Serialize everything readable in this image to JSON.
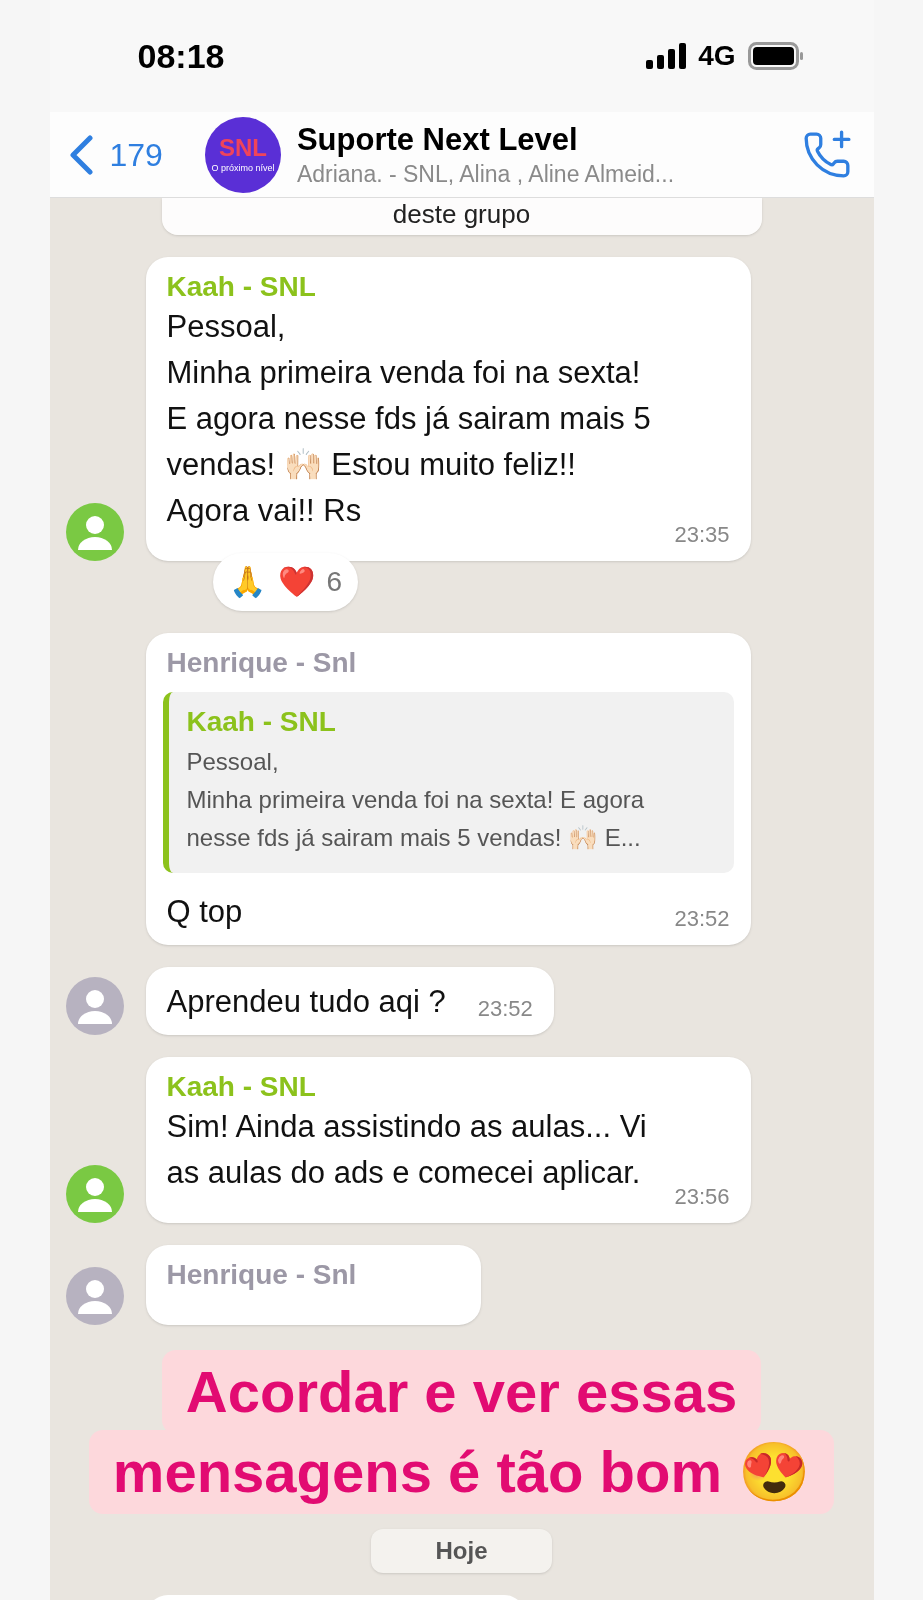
{
  "status_bar": {
    "time": "08:18",
    "network": "4G"
  },
  "header": {
    "back_count": "179",
    "logo": {
      "text": "SNL",
      "tagline": "O próximo nível"
    },
    "title": "Suporte Next Level",
    "subtitle": "Adriana. - SNL, Alina , Aline Almeid..."
  },
  "messages": [
    {
      "kind": "system",
      "lines": [
        "deste grupo"
      ]
    },
    {
      "kind": "incoming",
      "sender": "Kaah - SNL",
      "color": "#8cc21c",
      "avatar": {
        "color": "#7ac943"
      },
      "lines": [
        "Pessoal,",
        "Minha primeira venda foi na sexta!",
        "E agora nesse fds já sairam mais 5",
        "vendas! 🙌🏻 Estou muito feliz!!",
        "Agora vai!! Rs"
      ],
      "time": "23:35",
      "reactions": {
        "emojis": [
          "🙏",
          "❤️"
        ],
        "count": "6"
      }
    },
    {
      "kind": "incoming",
      "sender": "Henrique - Snl",
      "color": "#9c98a6",
      "quote": {
        "sender": "Kaah - SNL",
        "color": "#8cc21c",
        "lines": [
          "Pessoal,",
          "Minha primeira venda foi na sexta! E agora",
          "nesse fds já sairam mais 5 vendas! 🙌🏻 E..."
        ]
      },
      "lines": [
        "Q top"
      ],
      "time": "23:52"
    },
    {
      "kind": "incoming",
      "avatar": {
        "color": "#b7b2c0"
      },
      "lines": [
        "Aprendeu tudo aqi ?"
      ],
      "time": "23:52"
    },
    {
      "kind": "incoming",
      "sender": "Kaah - SNL",
      "color": "#8cc21c",
      "avatar": {
        "color": "#7ac943"
      },
      "lines": [
        "Sim! Ainda assistindo as aulas... Vi",
        "as aulas do ads e comecei aplicar."
      ],
      "time": "23:56"
    },
    {
      "kind": "incoming",
      "sender": "Henrique - Snl",
      "color": "#9c98a6",
      "avatar": {
        "color": "#b7b2c0"
      }
    },
    {
      "kind": "date",
      "lines": [
        "Hoje"
      ]
    }
  ],
  "caption": {
    "lines": [
      "Acordar e ver essas",
      "mensagens é tão bom 😍"
    ]
  }
}
